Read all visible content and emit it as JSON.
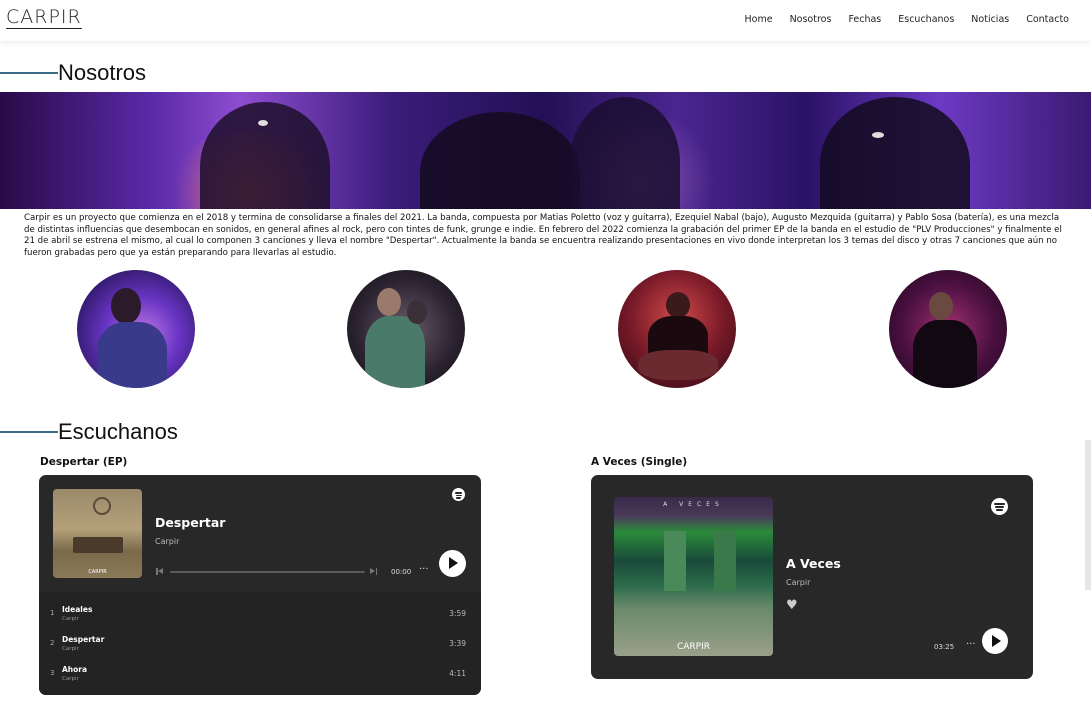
{
  "brand": {
    "logo": "CARPIR"
  },
  "nav": {
    "items": [
      "Home",
      "Nosotros",
      "Fechas",
      "Escuchanos",
      "Noticias",
      "Contacto"
    ]
  },
  "about": {
    "title": "Nosotros",
    "text": "Carpir es un proyecto que comienza en el 2018 y termina de consolidarse a finales del 2021. La banda, compuesta por Matias Poletto (voz y guitarra), Ezequiel Nabal (bajo), Augusto Mezquida (guitarra) y Pablo Sosa (batería), es una mezcla de distintas influencias que desembocan en sonidos, en general afines al rock, pero con tintes de funk, grunge e indie. En febrero del 2022 comienza la grabación del primer EP de la banda en el estudio de \"PLV Producciones\" y finalmente el 21 de abril se estrena el mismo, al cual lo componen 3 canciones y lleva el nombre \"Despertar\". Actualmente la banda se encuentra realizando presentaciones en vivo donde interpretan los 3 temas del disco y otras 7 canciones que aún no fueron grabadas pero que ya están preparando para llevarlas al estudio."
  },
  "listen": {
    "title": "Escuchanos",
    "ep": {
      "label": "Despertar (EP)",
      "title": "Despertar",
      "artist": "Carpir",
      "time": "00:00",
      "cover_text": "CARPIR",
      "tracks": [
        {
          "num": "1",
          "name": "Ideales",
          "artist": "Carpir",
          "duration": "3:59"
        },
        {
          "num": "2",
          "name": "Despertar",
          "artist": "Carpir",
          "duration": "3:39"
        },
        {
          "num": "3",
          "name": "Ahora",
          "artist": "Carpir",
          "duration": "4:11"
        }
      ]
    },
    "single": {
      "label": "A Veces (Single)",
      "title": "A Veces",
      "artist": "Carpir",
      "duration": "03:25",
      "cover_top": "A VECES",
      "cover_text": "CARPIR"
    }
  },
  "colors": {
    "accent_line": "#3a6a86",
    "player_bg": "#282828"
  }
}
